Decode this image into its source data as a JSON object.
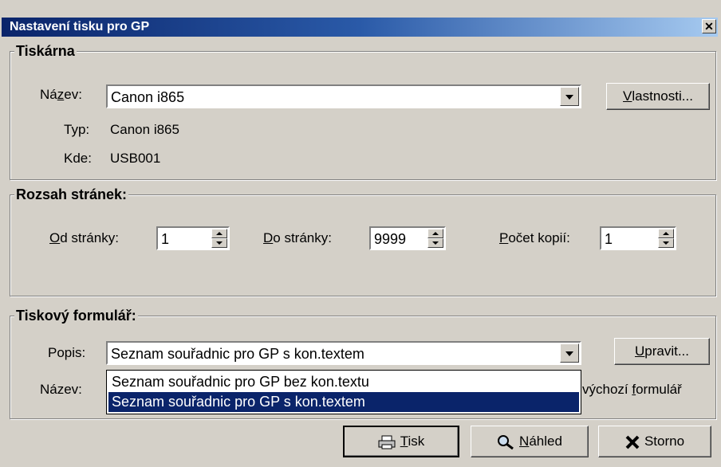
{
  "window": {
    "title": "Nastavení tisku pro GP",
    "close_glyph": "✕"
  },
  "printer": {
    "legend": "Tiskárna",
    "name_label_pre": "Ná",
    "name_label_u": "z",
    "name_label_post": "ev:",
    "name_value": "Canon i865",
    "properties_u": "V",
    "properties_rest": "lastnosti...",
    "type_label": "Typ:",
    "type_value": "Canon i865",
    "where_label": "Kde:",
    "where_value": "USB001"
  },
  "range": {
    "legend": "Rozsah stránek:",
    "from_u": "O",
    "from_rest": "d stránky:",
    "from_value": "1",
    "to_u": "D",
    "to_rest": "o stránky:",
    "to_value": "9999",
    "copies_u": "P",
    "copies_rest": "očet kopií:",
    "copies_value": "1"
  },
  "form": {
    "legend": "Tiskový formulář:",
    "desc_label": "Popis:",
    "desc_value": "Seznam souřadnic pro GP s kon.textem",
    "edit_u": "U",
    "edit_rest": "pravit...",
    "name_label": "Název:",
    "default_pre": "výchozí ",
    "default_u": "f",
    "default_post": "ormulář",
    "options": [
      "Seznam souřadnic pro GP bez kon.textu",
      "Seznam souřadnic pro GP s kon.textem"
    ],
    "selected_option": "Seznam souřadnic pro GP s kon.textem"
  },
  "buttons": {
    "print_u": "T",
    "print_rest": "isk",
    "print_icon": "printer-icon",
    "preview_u": "N",
    "preview_rest": "áhled",
    "preview_icon": "magnifier-icon",
    "cancel": "Storno",
    "cancel_icon": "x-icon"
  },
  "colors": {
    "face": "#d4d0c8",
    "title_start": "#0a246a",
    "title_end": "#a6caf0",
    "selection": "#0a246a"
  }
}
